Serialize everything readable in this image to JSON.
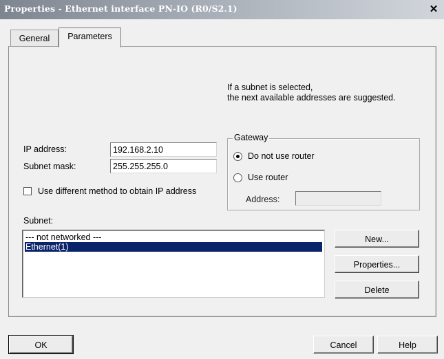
{
  "window": {
    "title": "Properties - Ethernet interface  PN-IO (R0/S2.1)",
    "close_glyph": "✕"
  },
  "tabs": [
    {
      "label": "General"
    },
    {
      "label": "Parameters",
      "active": true
    }
  ],
  "hint": {
    "line1": "If a subnet is selected,",
    "line2": "the next available addresses are suggested."
  },
  "ip": {
    "label": "IP address:",
    "value": "192.168.2.10"
  },
  "mask": {
    "label": "Subnet mask:",
    "value": "255.255.255.0"
  },
  "alt_method": {
    "label": "Use different method to obtain IP address",
    "checked": false
  },
  "gateway": {
    "title": "Gateway",
    "no_router_label": "Do not use router",
    "use_router_label": "Use router",
    "address_label": "Address:",
    "address_value": "",
    "selected": "no_router"
  },
  "subnet": {
    "label": "Subnet:",
    "items": [
      {
        "label": "--- not networked ---"
      },
      {
        "label": "Ethernet(1)",
        "selected": true
      }
    ]
  },
  "subnet_buttons": {
    "new_label": "New...",
    "properties_label": "Properties...",
    "delete_label": "Delete"
  },
  "footer": {
    "ok_label": "OK",
    "cancel_label": "Cancel",
    "help_label": "Help"
  },
  "colors": {
    "selection_bg": "#0a246a",
    "selection_text": "#ffffff",
    "dialog_bg": "#f0f0f0"
  }
}
